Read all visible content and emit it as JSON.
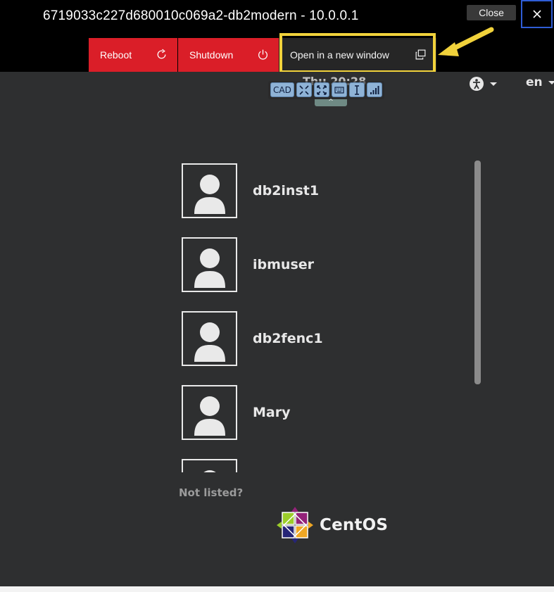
{
  "header": {
    "vm_title": "6719033c227d680010c069a2-db2modern - 10.0.0.1",
    "close_tooltip": "Close"
  },
  "actions": {
    "reboot_label": "Reboot",
    "shutdown_label": "Shutdown",
    "open_window_label": "Open in a new window"
  },
  "console": {
    "clock": "Thu 20:28",
    "novnc_toolbar": [
      "CAD",
      "fullscreen-exit-icon",
      "fullscreen-icon",
      "keyboard-icon",
      "text-cursor-icon",
      "signal-icon"
    ],
    "language": "en",
    "users": [
      {
        "name": "db2inst1"
      },
      {
        "name": "ibmuser"
      },
      {
        "name": "db2fenc1"
      },
      {
        "name": "Mary"
      }
    ],
    "not_listed": "Not listed?",
    "brand": "CentOS"
  },
  "colors": {
    "action_red": "#da1e28",
    "highlight_yellow": "#f1d23b",
    "console_bg": "#2e2f30"
  }
}
